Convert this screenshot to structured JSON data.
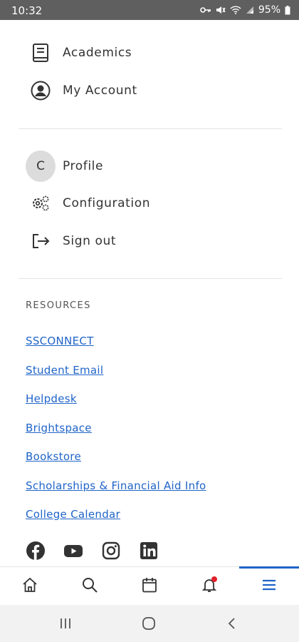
{
  "status_bar": {
    "time": "10:32",
    "battery": "95%",
    "icons": [
      "key-icon",
      "mute-icon",
      "wifi-icon",
      "signal-icon",
      "battery-icon"
    ]
  },
  "menu": {
    "top_items": [
      {
        "label": "Academics",
        "icon": "book-icon"
      },
      {
        "label": "My Account",
        "icon": "account-circle-icon"
      }
    ],
    "profile": {
      "avatar_letter": "C",
      "label": "Profile"
    },
    "configuration": {
      "label": "Configuration",
      "icon": "gears-icon"
    },
    "sign_out": {
      "label": "Sign out",
      "icon": "sign-out-icon"
    }
  },
  "resources": {
    "title": "RESOURCES",
    "links": [
      "SSCONNECT",
      "Student Email",
      "Helpdesk",
      "Brightspace",
      "Bookstore",
      "Scholarships & Financial Aid Info",
      "College Calendar"
    ]
  },
  "social": [
    "facebook-icon",
    "youtube-icon",
    "instagram-icon",
    "linkedin-icon"
  ],
  "tab_bar": {
    "tabs": [
      "home-icon",
      "search-icon",
      "calendar-icon",
      "bell-icon",
      "menu-icon"
    ],
    "active": "menu-icon",
    "notification_dot": true
  },
  "system_nav": [
    "recents-icon",
    "home-circle-icon",
    "back-icon"
  ],
  "colors": {
    "accent": "#1f64c8",
    "status_bar": "#5f5f5f",
    "badge": "#e0202a"
  }
}
